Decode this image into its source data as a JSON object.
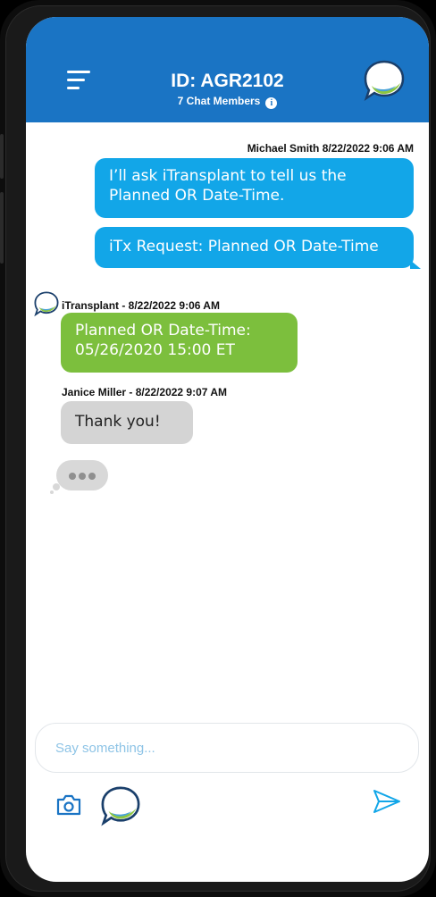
{
  "header": {
    "chat_id": "ID: AGR2102",
    "members": "7 Chat Members",
    "info_glyph": "i"
  },
  "messages": {
    "m1": {
      "meta": "Michael Smith 8/22/2022 9:06 AM",
      "text": "I’ll ask iTransplant to tell us the Planned OR Date-Time."
    },
    "m2": {
      "text": "iTx Request: Planned OR Date-Time"
    },
    "m3": {
      "meta": "iTransplant - 8/22/2022 9:06 AM",
      "line1": "Planned OR Date-Time:",
      "line2": "05/26/2020 15:00 ET"
    },
    "m4": {
      "meta": "Janice Miller - 8/22/2022 9:07 AM",
      "text": "Thank you!"
    }
  },
  "composer": {
    "placeholder": "Say something..."
  },
  "icons": {
    "menu": "hamburger-menu-icon",
    "info": "info-icon",
    "logo": "chat-bubble-logo-icon",
    "camera": "camera-icon",
    "send": "send-icon"
  },
  "colors": {
    "header": "#1a74c4",
    "outgoing": "#12a6e8",
    "bot": "#7cbf3d",
    "incoming": "#d4d4d4",
    "accent_green": "#8dc63f",
    "placeholder": "#8ec4e6"
  }
}
